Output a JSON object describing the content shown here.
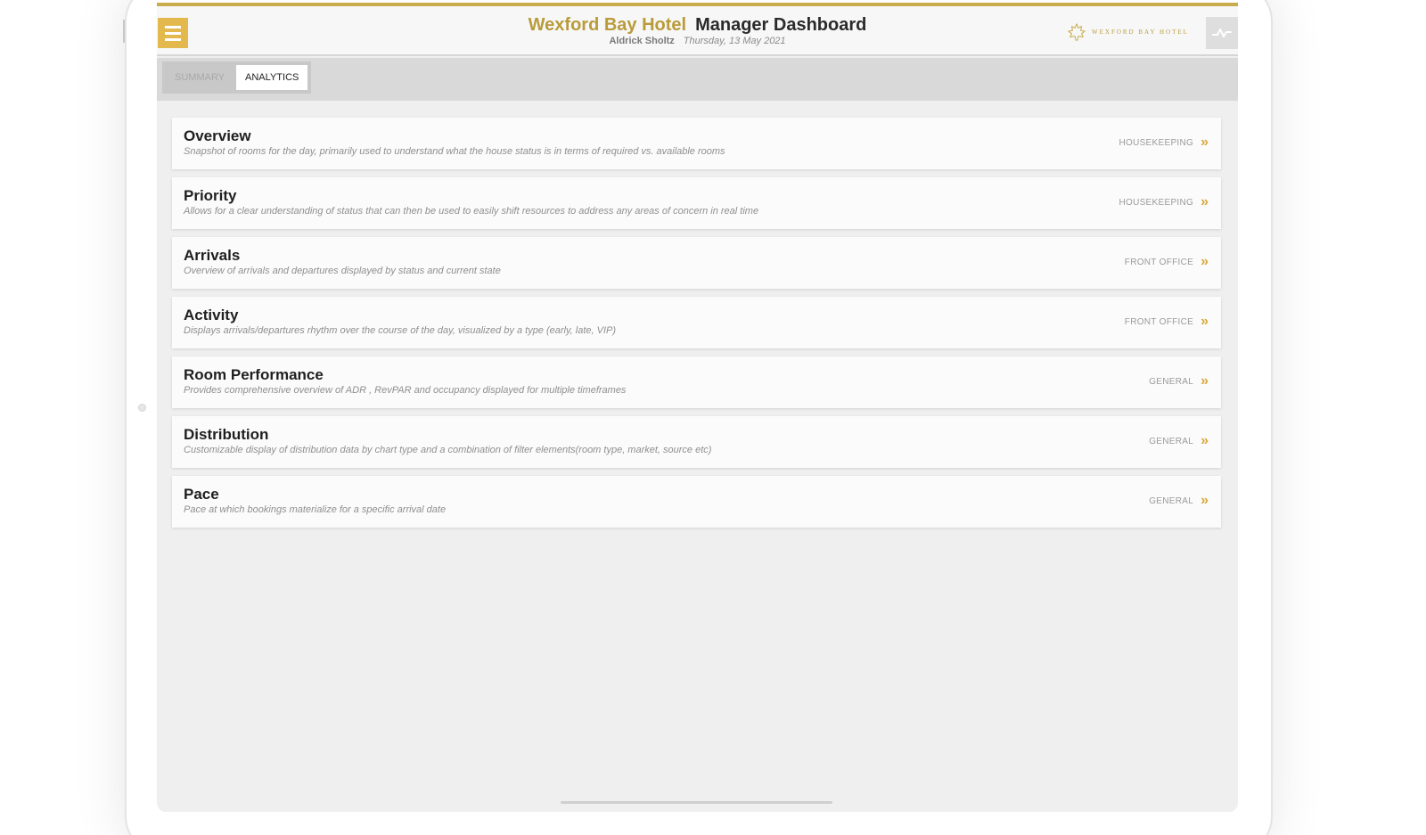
{
  "header": {
    "hotel_name": "Wexford Bay Hotel",
    "dashboard_title": "Manager Dashboard",
    "user_name": "Aldrick Sholtz",
    "date": "Thursday, 13 May 2021",
    "logo_text": "WEXFORD BAY HOTEL"
  },
  "tabs": [
    {
      "label": "SUMMARY",
      "active": false
    },
    {
      "label": "ANALYTICS",
      "active": true
    }
  ],
  "cards": [
    {
      "title": "Overview",
      "description": "Snapshot of rooms for the day, primarily used to understand what the house status is in terms of required vs. available rooms",
      "category": "HOUSEKEEPING"
    },
    {
      "title": "Priority",
      "description": "Allows for a clear understanding of status that can then be used to easily shift resources to address any areas of concern in real time",
      "category": "HOUSEKEEPING"
    },
    {
      "title": "Arrivals",
      "description": "Overview of arrivals and departures displayed by status and current state",
      "category": "FRONT OFFICE"
    },
    {
      "title": "Activity",
      "description": "Displays arrivals/departures rhythm over the course of the day, visualized by a type (early, late, VIP)",
      "category": "FRONT OFFICE"
    },
    {
      "title": "Room Performance",
      "description": "Provides comprehensive overview of ADR , RevPAR and occupancy displayed for multiple timeframes",
      "category": "GENERAL"
    },
    {
      "title": "Distribution",
      "description": "Customizable display of distribution data by chart type and a combination of filter elements(room type, market, source etc)",
      "category": "GENERAL"
    },
    {
      "title": "Pace",
      "description": "Pace at which bookings materialize for a specific arrival date",
      "category": "GENERAL"
    }
  ],
  "icons": {
    "menu": "hamburger-icon",
    "chevron": "double-chevron-right-icon",
    "activity": "activity-line-icon",
    "logo": "maple-leaf-icon"
  },
  "colors": {
    "accent_gold": "#c8ac4e",
    "menu_button": "#e3b94d",
    "chevron": "#d8a93a"
  }
}
